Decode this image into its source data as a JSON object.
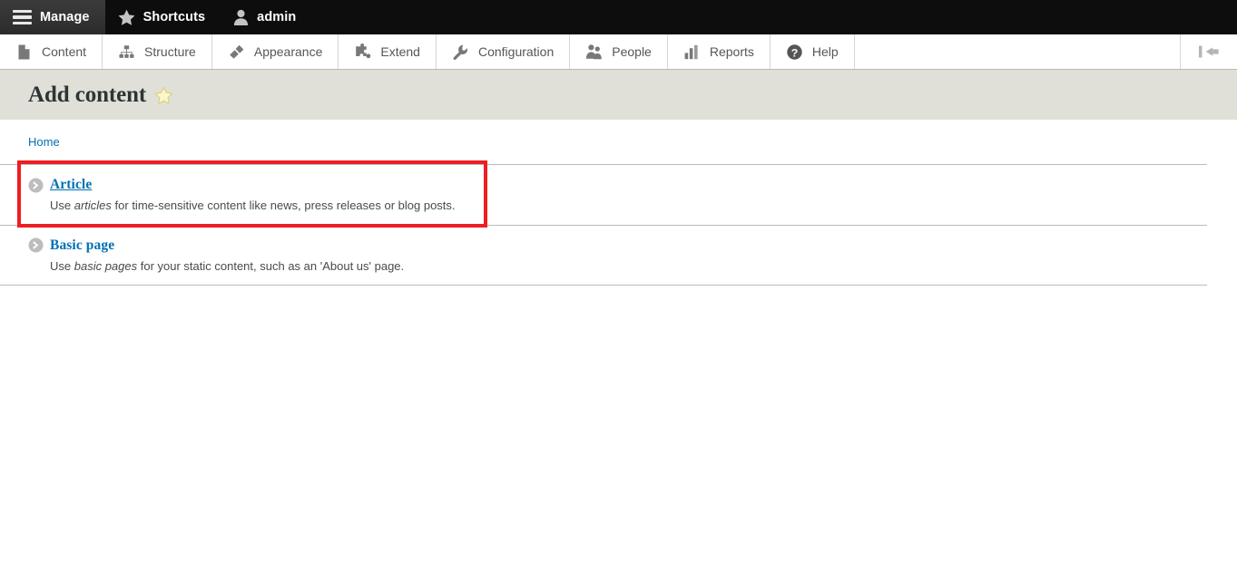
{
  "admin_bar": {
    "items": [
      {
        "label": "Manage",
        "icon": "hamburger-icon",
        "active": true
      },
      {
        "label": "Shortcuts",
        "icon": "star-icon",
        "active": false
      },
      {
        "label": "admin",
        "icon": "person-icon",
        "active": false
      }
    ]
  },
  "menu_bar": {
    "items": [
      {
        "label": "Content",
        "icon": "document-icon"
      },
      {
        "label": "Structure",
        "icon": "sitemap-icon"
      },
      {
        "label": "Appearance",
        "icon": "paintbrush-icon"
      },
      {
        "label": "Extend",
        "icon": "puzzle-piece-icon"
      },
      {
        "label": "Configuration",
        "icon": "wrench-icon"
      },
      {
        "label": "People",
        "icon": "people-icon"
      },
      {
        "label": "Reports",
        "icon": "bar-chart-icon"
      },
      {
        "label": "Help",
        "icon": "question-mark-icon"
      }
    ],
    "orientation_toggle": "vertical-orientation-icon"
  },
  "page": {
    "title": "Add content",
    "title_star": "star-outline-icon",
    "breadcrumb": [
      {
        "label": "Home"
      }
    ]
  },
  "content_types": [
    {
      "name": "Article",
      "description_prefix": "Use ",
      "description_em": "articles",
      "description_suffix": " for time-sensitive content like news, press releases or blog posts.",
      "hovered": true
    },
    {
      "name": "Basic page",
      "description_prefix": "Use ",
      "description_em": "basic pages",
      "description_suffix": " for your static content, such as an 'About us' page.",
      "hovered": false
    }
  ],
  "annotation": {
    "color": "#ee1d23",
    "target": "Article"
  },
  "colors": {
    "admin_bar_bg": "#0d0d0d",
    "active_tab_bg": "#333333",
    "title_band_bg": "#e0e0d8",
    "link_blue": "#0071b3",
    "annotation_red": "#ee1d23",
    "star_yellow": "#fdf6c8"
  }
}
